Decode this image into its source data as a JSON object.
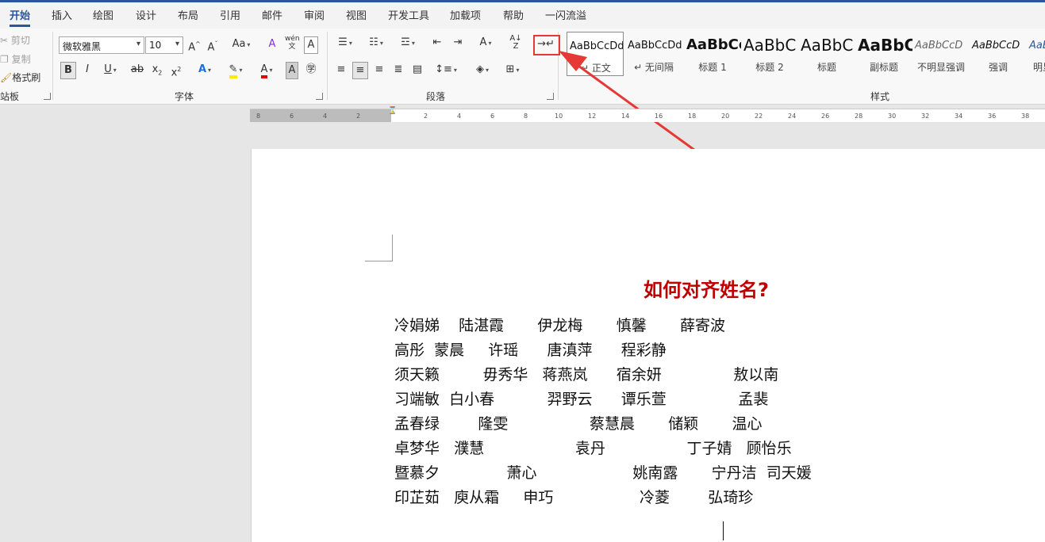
{
  "tabs": [
    "开始",
    "插入",
    "绘图",
    "设计",
    "布局",
    "引用",
    "邮件",
    "审阅",
    "视图",
    "开发工具",
    "加载项",
    "帮助",
    "一闪流溢"
  ],
  "clipboard": {
    "cut": "剪切",
    "copy": "复制",
    "format_painter": "格式刷",
    "label": "站板"
  },
  "font": {
    "name": "微软雅黑",
    "size": "10",
    "label": "字体"
  },
  "paragraph": {
    "label": "段落"
  },
  "styles": {
    "label": "样式",
    "items": [
      {
        "preview": "AaBbCcDd",
        "name": "↵ 正文"
      },
      {
        "preview": "AaBbCcDd",
        "name": "↵ 无间隔"
      },
      {
        "preview": "AaBbCc",
        "name": "标题 1"
      },
      {
        "preview": "AaBbC",
        "name": "标题 2"
      },
      {
        "preview": "AaBbC",
        "name": "标题"
      },
      {
        "preview": "AaBbC",
        "name": "副标题"
      },
      {
        "preview": "AaBbCcD",
        "name": "不明显强调"
      },
      {
        "preview": "AaBbCcD",
        "name": "强调"
      },
      {
        "preview": "AaBl",
        "name": "明显"
      }
    ]
  },
  "ruler_ticks": [
    "8",
    "6",
    "4",
    "2",
    "2",
    "4",
    "6",
    "8",
    "10",
    "12",
    "14",
    "16",
    "18",
    "20",
    "22",
    "24",
    "26",
    "28",
    "30",
    "32",
    "34",
    "36",
    "38"
  ],
  "document": {
    "title": "如何对齐姓名?",
    "lines": [
      "冷娟娣    陆湛霞       伊龙梅       慎馨       薛寄波",
      "高彤  蒙晨     许瑶      唐滇萍      程彩静",
      "须天籁         毋秀华   蒋燕岚      宿余妍               敖以南",
      "习端敏  白小春           羿野云      谭乐萱               孟裴",
      "孟春绿        隆雯                 蔡慧晨       储颖       温心",
      "卓梦华   濮慧                   袁丹                 丁子婧   顾怡乐",
      "暨慕夕              萧心                    姚南露       宁丹洁  司天媛",
      "印芷茹   庾从霜     申巧                  冷菱        弘琦珍"
    ]
  },
  "colors": {
    "accent": "#2b579a",
    "title_red": "#c00000",
    "annotation_red": "#e53935"
  }
}
